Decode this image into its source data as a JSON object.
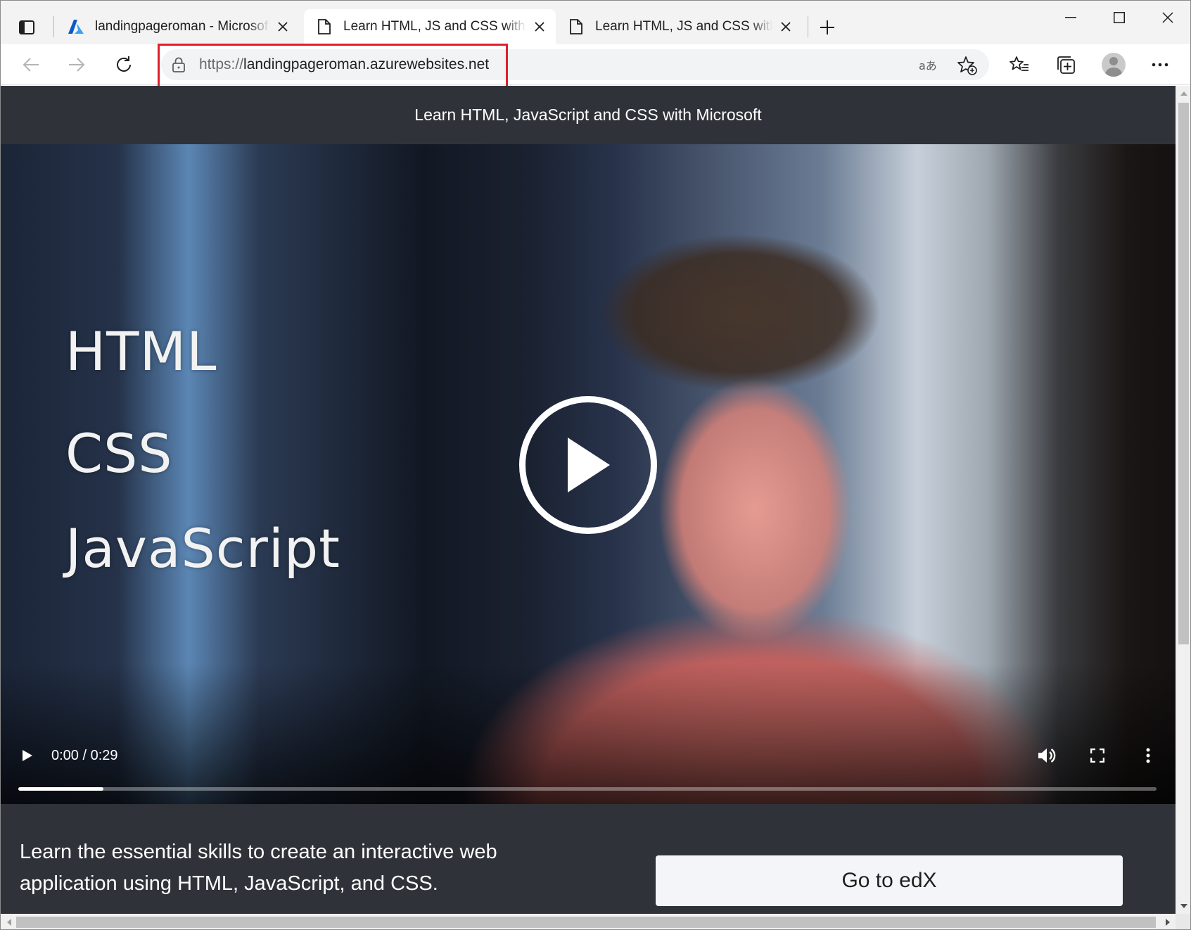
{
  "browser": {
    "tabs": [
      {
        "title": "landingpageroman - Microsoft Azure",
        "icon": "azure-logo-icon",
        "active": false
      },
      {
        "title": "Learn HTML, JS and CSS with Microsoft",
        "icon": "page-icon",
        "active": true
      },
      {
        "title": "Learn HTML, JS and CSS with Microsoft",
        "icon": "page-icon",
        "active": false
      }
    ],
    "address": {
      "scheme": "https://",
      "host": "landingpageroman.azurewebsites.net"
    },
    "colors": {
      "highlight": "#e0202a",
      "azure_blue": "#0078d4"
    }
  },
  "page": {
    "header_title": "Learn HTML, JavaScript and CSS with Microsoft",
    "video": {
      "overlay_lines": [
        "HTML",
        "CSS",
        "JavaScript"
      ],
      "time_display": "0:00 / 0:29",
      "progress_fraction": 0.075
    },
    "description": "Learn the essential skills to create an interactive web application using HTML, JavaScript, and CSS.",
    "cta_label": "Go to edX",
    "colors": {
      "background": "#2f3339",
      "button_bg": "#f3f5f8"
    }
  }
}
